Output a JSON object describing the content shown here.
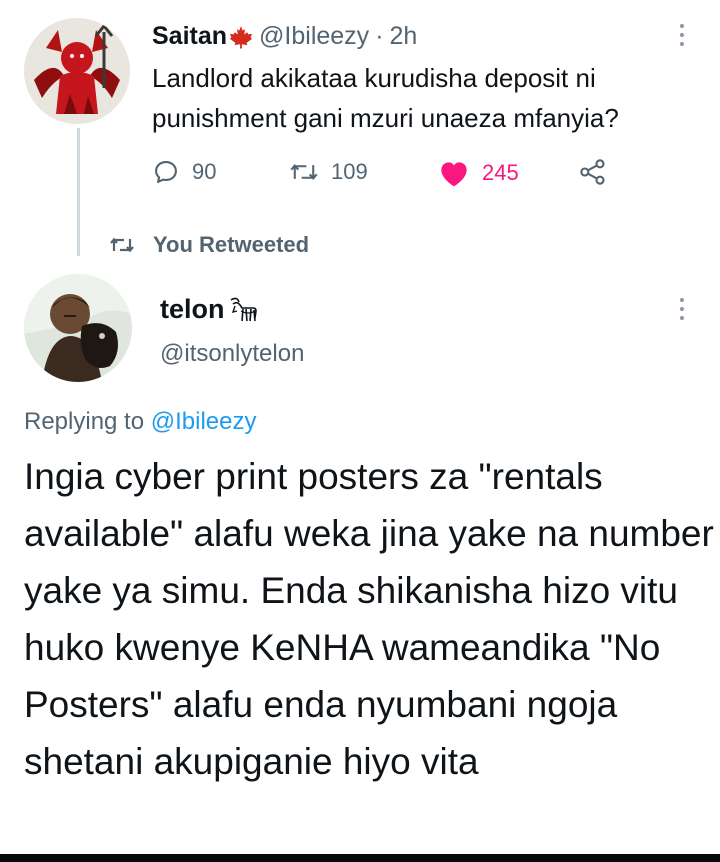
{
  "colors": {
    "text": "#0f1419",
    "muted": "#536471",
    "link": "#1d9bf0",
    "like": "#f91880",
    "thread_line": "#cfd9de",
    "maple_leaf": "#d52b1e"
  },
  "original_tweet": {
    "display_name": "Saitan",
    "name_emoji": "maple-leaf-flag",
    "handle": "@Ibileezy",
    "separator": "·",
    "time": "2h",
    "text": "Landlord akikataa kurudisha deposit ni punishment gani mzuri unaeza mfanyia?",
    "avatar_icon": "devil-avatar",
    "stats": {
      "replies": "90",
      "retweets": "109",
      "likes": "245"
    },
    "liked": true
  },
  "retweet_context": {
    "label": "You Retweeted",
    "icon": "retweet-icon"
  },
  "reply_tweet": {
    "display_name": "telon",
    "name_emoji": "goat-glyph",
    "handle": "@itsonlytelon",
    "replying_prefix": "Replying to",
    "replying_to": "@Ibileezy",
    "text": "Ingia cyber print posters za \"rentals available\" alafu weka jina yake na number yake ya simu. Enda shikanisha hizo vitu huko kwenye KeNHA wameandika \"No Posters\" alafu enda nyumbani ngoja shetani akupiganie hiyo vita",
    "avatar_icon": "person-with-dog-avatar"
  }
}
